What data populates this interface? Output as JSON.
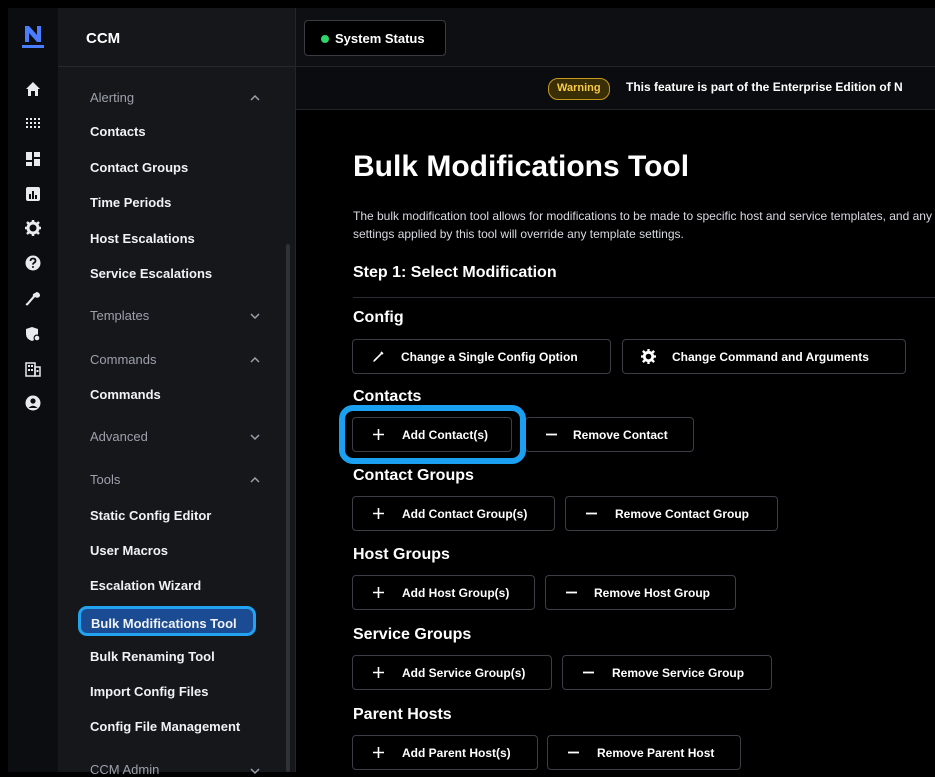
{
  "app": {
    "logo_letter": "N",
    "accent": "#4a7dff"
  },
  "rail": {
    "icons": [
      "home-icon",
      "apps-grid-icon",
      "dashboard-icon",
      "chart-icon",
      "gear-icon",
      "help-icon",
      "wrench-icon",
      "shield-gear-icon",
      "building-icon",
      "user-circle-icon"
    ]
  },
  "nav": {
    "title": "CCM",
    "sections": {
      "alerting": "Alerting",
      "templates": "Templates",
      "commands": "Commands",
      "advanced": "Advanced",
      "tools": "Tools",
      "ccm_admin": "CCM Admin"
    },
    "items": {
      "contacts": "Contacts",
      "contact_groups": "Contact Groups",
      "time_periods": "Time Periods",
      "host_escalations": "Host Escalations",
      "service_escalations": "Service Escalations",
      "commands": "Commands",
      "static_config_editor": "Static Config Editor",
      "user_macros": "User Macros",
      "escalation_wizard": "Escalation Wizard",
      "bulk_modifications_tool": "Bulk Modifications Tool",
      "bulk_renaming_tool": "Bulk Renaming Tool",
      "import_config_files": "Import Config Files",
      "config_file_management": "Config File Management"
    }
  },
  "topbar": {
    "status_label": "System Status",
    "status_color": "#2fd26b"
  },
  "banner": {
    "badge": "Warning",
    "text": "This feature is part of the Enterprise Edition of N"
  },
  "main": {
    "title": "Bulk Modifications Tool",
    "description": "The bulk modification tool allows for modifications to be made to specific host and service templates, and any settings applied by this tool will override any template settings.",
    "step": "Step 1: Select Modification",
    "groups": {
      "config": "Config",
      "contacts": "Contacts",
      "contact_groups": "Contact Groups",
      "host_groups": "Host Groups",
      "service_groups": "Service Groups",
      "parent_hosts": "Parent Hosts"
    },
    "buttons": {
      "change_single_config": "Change a Single Config Option",
      "change_command": "Change Command and Arguments",
      "add_contacts": "Add Contact(s)",
      "remove_contact": "Remove Contact",
      "add_contact_groups": "Add Contact Group(s)",
      "remove_contact_group": "Remove Contact Group",
      "add_host_groups": "Add Host Group(s)",
      "remove_host_group": "Remove Host Group",
      "add_service_groups": "Add Service Group(s)",
      "remove_service_group": "Remove Service Group",
      "add_parent_hosts": "Add Parent Host(s)",
      "remove_parent_host": "Remove Parent Host"
    }
  },
  "highlight_color": "#1b9ff0"
}
